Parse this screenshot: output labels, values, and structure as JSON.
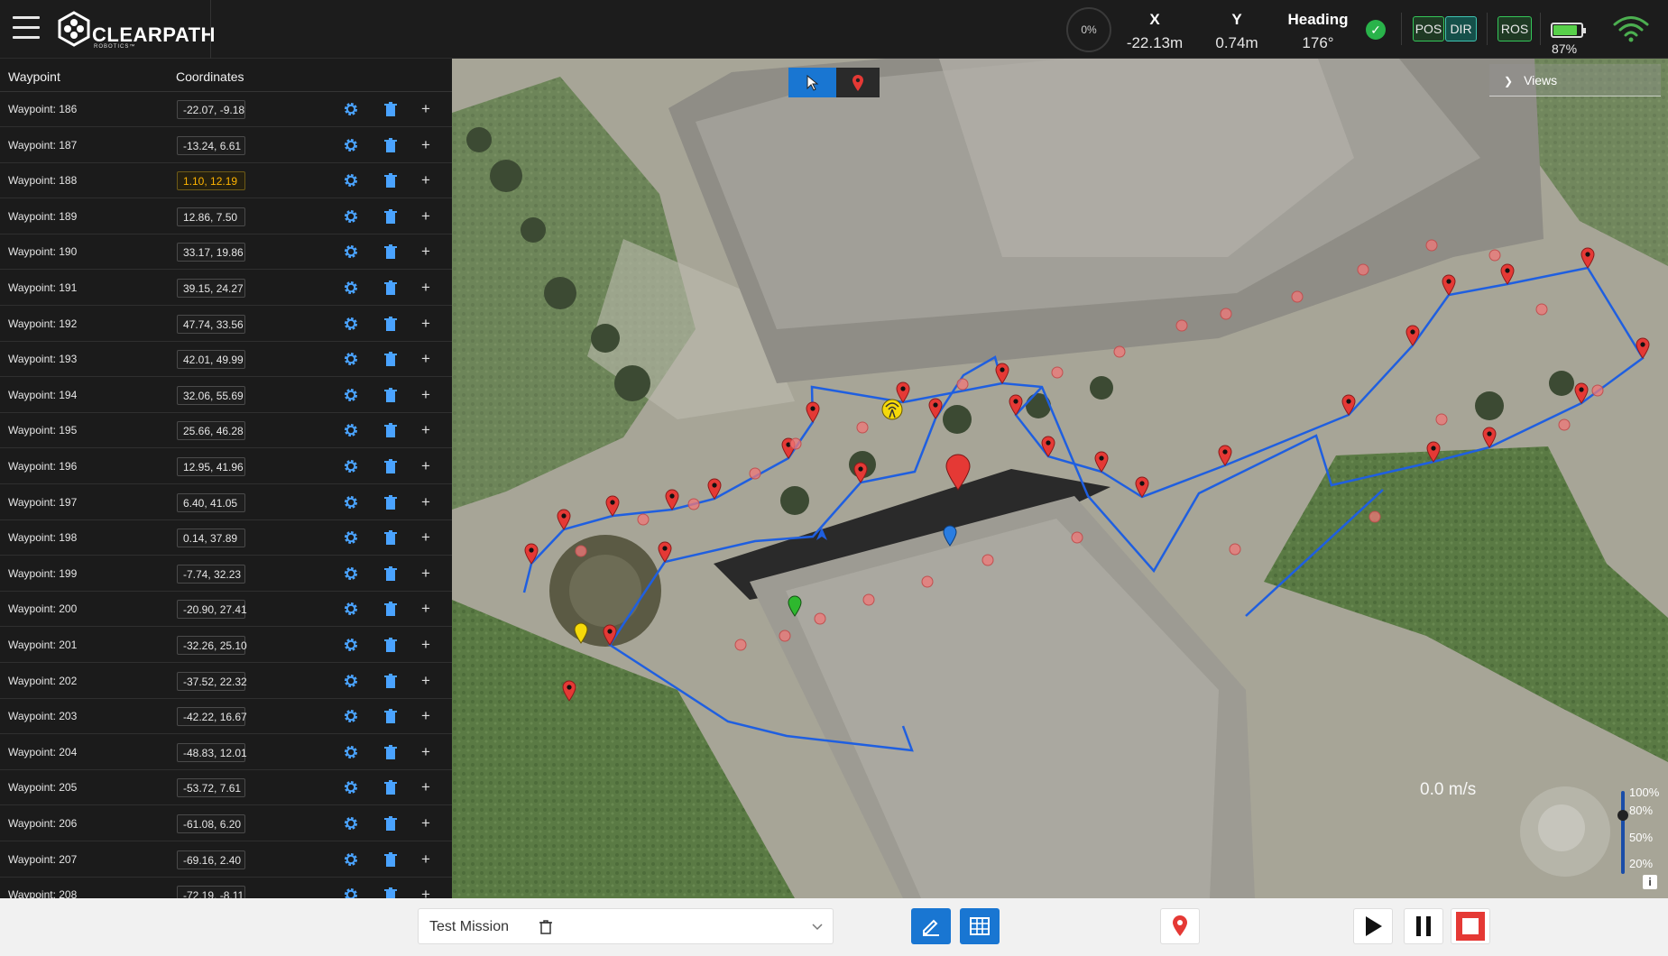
{
  "app": {
    "brand": "CLEARPATH",
    "brand_sub": "ROBOTICS™"
  },
  "topbar": {
    "progress_percent": "0%",
    "x_label": "X",
    "x_value": "-22.13m",
    "y_label": "Y",
    "y_value": "0.74m",
    "heading_label": "Heading",
    "heading_value": "176°",
    "status_ok": "✓",
    "pos_label": "POS",
    "dir_label": "DIR",
    "ros_label": "ROS",
    "battery_level": 0.87,
    "battery_percent": "87%"
  },
  "waypoint_panel": {
    "col_waypoint": "Waypoint",
    "col_coordinates": "Coordinates",
    "rows": [
      {
        "name": "Waypoint: 186",
        "coords": "-22.07, -9.18",
        "active": false
      },
      {
        "name": "Waypoint: 187",
        "coords": "-13.24, 6.61",
        "active": false
      },
      {
        "name": "Waypoint: 188",
        "coords": "1.10, 12.19",
        "active": true
      },
      {
        "name": "Waypoint: 189",
        "coords": "12.86, 7.50",
        "active": false
      },
      {
        "name": "Waypoint: 190",
        "coords": "33.17, 19.86",
        "active": false
      },
      {
        "name": "Waypoint: 191",
        "coords": "39.15, 24.27",
        "active": false
      },
      {
        "name": "Waypoint: 192",
        "coords": "47.74, 33.56",
        "active": false
      },
      {
        "name": "Waypoint: 193",
        "coords": "42.01, 49.99",
        "active": false
      },
      {
        "name": "Waypoint: 194",
        "coords": "32.06, 55.69",
        "active": false
      },
      {
        "name": "Waypoint: 195",
        "coords": "25.66, 46.28",
        "active": false
      },
      {
        "name": "Waypoint: 196",
        "coords": "12.95, 41.96",
        "active": false
      },
      {
        "name": "Waypoint: 197",
        "coords": "6.40, 41.05",
        "active": false
      },
      {
        "name": "Waypoint: 198",
        "coords": "0.14, 37.89",
        "active": false
      },
      {
        "name": "Waypoint: 199",
        "coords": "-7.74, 32.23",
        "active": false
      },
      {
        "name": "Waypoint: 200",
        "coords": "-20.90, 27.41",
        "active": false
      },
      {
        "name": "Waypoint: 201",
        "coords": "-32.26, 25.10",
        "active": false
      },
      {
        "name": "Waypoint: 202",
        "coords": "-37.52, 22.32",
        "active": false
      },
      {
        "name": "Waypoint: 203",
        "coords": "-42.22, 16.67",
        "active": false
      },
      {
        "name": "Waypoint: 204",
        "coords": "-48.83, 12.01",
        "active": false
      },
      {
        "name": "Waypoint: 205",
        "coords": "-53.72, 7.61",
        "active": false
      },
      {
        "name": "Waypoint: 206",
        "coords": "-61.08, 6.20",
        "active": false
      },
      {
        "name": "Waypoint: 207",
        "coords": "-69.16, 2.40",
        "active": false
      },
      {
        "name": "Waypoint: 208",
        "coords": "-72.19, -8.11",
        "active": false
      }
    ]
  },
  "map": {
    "views_label": "Views",
    "speed": "0.0 m/s",
    "speed_levels": [
      "100%",
      "80%",
      "50%",
      "20%"
    ],
    "speed_setting": 0.8,
    "info": "i",
    "path_color": "#1f5fe0",
    "waypoint_color": "#e53935"
  },
  "bottombar": {
    "mission_name": "Test Mission"
  }
}
